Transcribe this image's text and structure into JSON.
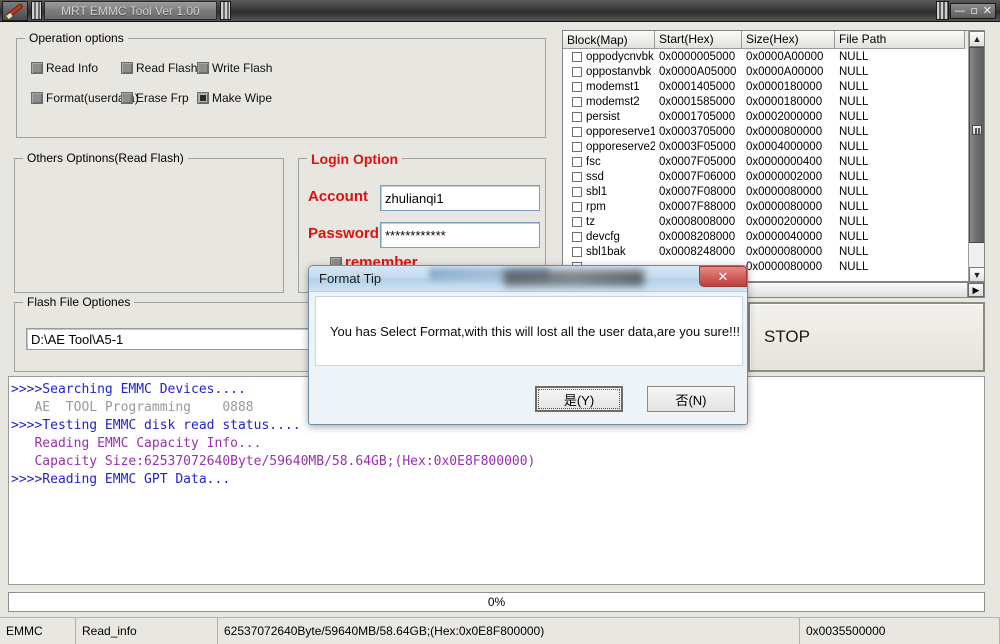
{
  "window": {
    "app_icon": "pen-tool-icon",
    "tab_title": "MRT EMMC Tool Ver 1.00",
    "minimize": "—",
    "maximize": "▫",
    "close": "✕"
  },
  "operation_options": {
    "title": "Operation options",
    "items": [
      {
        "label": "Read Info",
        "checked": false
      },
      {
        "label": "Read Flash",
        "checked": false
      },
      {
        "label": "Write Flash",
        "checked": false
      },
      {
        "label": "Format(userdata)",
        "checked": false
      },
      {
        "label": "Erase Frp",
        "checked": false
      },
      {
        "label": "Make Wipe",
        "checked": true
      }
    ]
  },
  "others_options": {
    "title": "Others Optinons(Read Flash)"
  },
  "login_option": {
    "title": "Login Option",
    "account_label": "Account",
    "account_value": "zhulianqi1",
    "password_label": "Password",
    "password_value": "************",
    "remember_label": "remember",
    "remember_checked": false
  },
  "flash_file_options": {
    "title": "Flash File Optiones",
    "path_value": "D:\\AE Tool\\A5-1"
  },
  "stop_button": {
    "label": "STOP"
  },
  "partition_table": {
    "columns": [
      "Block(Map)",
      "Start(Hex)",
      "Size(Hex)",
      "File Path"
    ],
    "rows": [
      {
        "block": "oppodycnvbk",
        "start": "0x0000005000",
        "size": "0x0000A00000",
        "path": "NULL",
        "checked": false
      },
      {
        "block": "oppostanvbk",
        "start": "0x0000A05000",
        "size": "0x0000A00000",
        "path": "NULL",
        "checked": false
      },
      {
        "block": "modemst1",
        "start": "0x0001405000",
        "size": "0x0000180000",
        "path": "NULL",
        "checked": false
      },
      {
        "block": "modemst2",
        "start": "0x0001585000",
        "size": "0x0000180000",
        "path": "NULL",
        "checked": false
      },
      {
        "block": "persist",
        "start": "0x0001705000",
        "size": "0x0002000000",
        "path": "NULL",
        "checked": false
      },
      {
        "block": "opporeserve1",
        "start": "0x0003705000",
        "size": "0x0000800000",
        "path": "NULL",
        "checked": false
      },
      {
        "block": "opporeserve2",
        "start": "0x0003F05000",
        "size": "0x0004000000",
        "path": "NULL",
        "checked": false
      },
      {
        "block": "fsc",
        "start": "0x0007F05000",
        "size": "0x0000000400",
        "path": "NULL",
        "checked": false
      },
      {
        "block": "ssd",
        "start": "0x0007F06000",
        "size": "0x0000002000",
        "path": "NULL",
        "checked": false
      },
      {
        "block": "sbl1",
        "start": "0x0007F08000",
        "size": "0x0000080000",
        "path": "NULL",
        "checked": false
      },
      {
        "block": "rpm",
        "start": "0x0007F88000",
        "size": "0x0000080000",
        "path": "NULL",
        "checked": false
      },
      {
        "block": "tz",
        "start": "0x0008008000",
        "size": "0x0000200000",
        "path": "NULL",
        "checked": false
      },
      {
        "block": "devcfg",
        "start": "0x0008208000",
        "size": "0x0000040000",
        "path": "NULL",
        "checked": false
      },
      {
        "block": "sbl1bak",
        "start": "0x0008248000",
        "size": "0x0000080000",
        "path": "NULL",
        "checked": false
      },
      {
        "block": "",
        "start": "",
        "size": "0x0000080000",
        "path": "NULL",
        "checked": false
      }
    ],
    "scroll_up": "▲",
    "scroll_down": "▼",
    "scroll_right": "▶"
  },
  "console": {
    "lines": [
      {
        "text": ">>>>Searching EMMC Devices....",
        "color": "blue"
      },
      {
        "text": "   AE  TOOL Programming    0888",
        "color": "gray"
      },
      {
        "text": ">>>>Testing EMMC disk read status....",
        "color": "blue"
      },
      {
        "text": "   Reading EMMC Capacity Info...",
        "color": "purple"
      },
      {
        "text": "   Capacity Size:62537072640Byte/59640MB/58.64GB;(Hex:0x0E8F800000)",
        "color": "purple"
      },
      {
        "text": ">>>>Reading EMMC GPT Data...",
        "color": "blue"
      }
    ]
  },
  "progress": {
    "percent_label": "0%",
    "value": 0
  },
  "status_bar": {
    "device": "EMMC",
    "operation": "Read_info",
    "capacity": "62537072640Byte/59640MB/58.64GB;(Hex:0x0E8F800000)",
    "address": "0x0035500000"
  },
  "dialog": {
    "title": "Format Tip",
    "close_label": "✕",
    "message": "You has Select Format,with this will lost all the user data,are you sure!!!",
    "yes_label": "是(Y)",
    "no_label": "否(N)"
  },
  "colors": {
    "login_accent": "#e01010",
    "console_blue": "#2222cc",
    "console_purple": "#9b2fae",
    "console_gray": "#999999",
    "dialog_close": "#cf5b56"
  }
}
